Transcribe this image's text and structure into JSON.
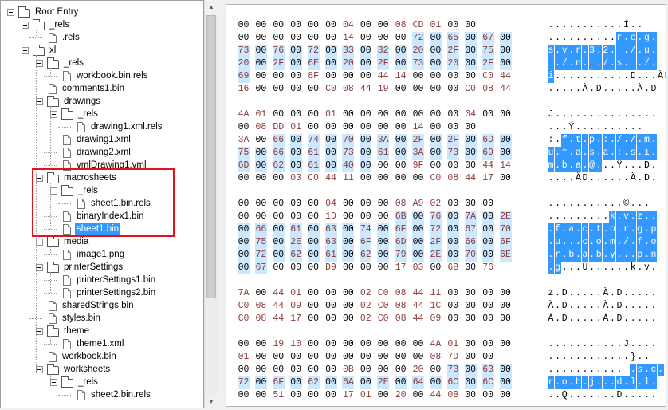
{
  "colors": {
    "highlight_hex": "#cce8ff",
    "highlight_ascii": "#3399ff",
    "selection": "#3399ff",
    "callout_border": "#e0141e",
    "zero_text": "#000000",
    "nonzero_text": "#8b3a3a"
  },
  "tree": {
    "items": [
      {
        "label": "Root Entry",
        "type": "folder",
        "depth": 0,
        "toggle": true
      },
      {
        "label": "_rels",
        "type": "folder",
        "depth": 1,
        "toggle": true
      },
      {
        "label": ".rels",
        "type": "file",
        "depth": 2
      },
      {
        "label": "xl",
        "type": "folder",
        "depth": 1,
        "toggle": true
      },
      {
        "label": "_rels",
        "type": "folder",
        "depth": 2,
        "toggle": true
      },
      {
        "label": "workbook.bin.rels",
        "type": "file",
        "depth": 3
      },
      {
        "label": "comments1.bin",
        "type": "file",
        "depth": 2
      },
      {
        "label": "drawings",
        "type": "folder",
        "depth": 2,
        "toggle": true
      },
      {
        "label": "_rels",
        "type": "folder",
        "depth": 3,
        "toggle": true
      },
      {
        "label": "drawing1.xml.rels",
        "type": "file",
        "depth": 4
      },
      {
        "label": "drawing1.xml",
        "type": "file",
        "depth": 3
      },
      {
        "label": "drawing2.xml",
        "type": "file",
        "depth": 3
      },
      {
        "label": "vmlDrawing1.vml",
        "type": "file",
        "depth": 3
      },
      {
        "label": "macrosheets",
        "type": "folder",
        "depth": 2,
        "toggle": true
      },
      {
        "label": "_rels",
        "type": "folder",
        "depth": 3,
        "toggle": true
      },
      {
        "label": "sheet1.bin.rels",
        "type": "file",
        "depth": 4
      },
      {
        "label": "binaryIndex1.bin",
        "type": "file",
        "depth": 3
      },
      {
        "label": "sheet1.bin",
        "type": "file",
        "depth": 3,
        "selected": true
      },
      {
        "label": "media",
        "type": "folder",
        "depth": 2,
        "toggle": true
      },
      {
        "label": "image1.png",
        "type": "file",
        "depth": 3
      },
      {
        "label": "printerSettings",
        "type": "folder",
        "depth": 2,
        "toggle": true
      },
      {
        "label": "printerSettings1.bin",
        "type": "file",
        "depth": 3
      },
      {
        "label": "printerSettings2.bin",
        "type": "file",
        "depth": 3
      },
      {
        "label": "sharedStrings.bin",
        "type": "file",
        "depth": 2
      },
      {
        "label": "styles.bin",
        "type": "file",
        "depth": 2
      },
      {
        "label": "theme",
        "type": "folder",
        "depth": 2,
        "toggle": true
      },
      {
        "label": "theme1.xml",
        "type": "file",
        "depth": 3
      },
      {
        "label": "workbook.bin",
        "type": "file",
        "depth": 2
      },
      {
        "label": "worksheets",
        "type": "folder",
        "depth": 2,
        "toggle": true
      },
      {
        "label": "_rels",
        "type": "folder",
        "depth": 3,
        "toggle": true
      },
      {
        "label": "sheet2.bin.rels",
        "type": "file",
        "depth": 4
      }
    ]
  },
  "scrollbar": {
    "up_glyph": "▲",
    "down_glyph": "▼"
  },
  "hex": {
    "rows": [
      {
        "bytes": [
          "00",
          "00",
          "00",
          "00",
          "00",
          "00",
          "04",
          "00",
          "00",
          "08",
          "CD",
          "01",
          "00",
          "00"
        ],
        "ascii": "...........Í..",
        "hl": []
      },
      {
        "bytes": [
          "00",
          "00",
          "00",
          "00",
          "00",
          "00",
          "14",
          "00",
          "00",
          "00",
          "72",
          "00",
          "65",
          "00",
          "67",
          "00"
        ],
        "ascii": "..........r.e.g.",
        "hl": [
          10,
          11,
          12,
          13,
          14,
          15
        ]
      },
      {
        "bytes": [
          "73",
          "00",
          "76",
          "00",
          "72",
          "00",
          "33",
          "00",
          "32",
          "00",
          "20",
          "00",
          "2F",
          "00",
          "75",
          "00"
        ],
        "ascii": "s.v.r.3.2. ./.u.",
        "hl": [
          0,
          1,
          2,
          3,
          4,
          5,
          6,
          7,
          8,
          9,
          10,
          11,
          12,
          13,
          14,
          15
        ]
      },
      {
        "bytes": [
          "20",
          "00",
          "2F",
          "00",
          "6E",
          "00",
          "20",
          "00",
          "2F",
          "00",
          "73",
          "00",
          "20",
          "00",
          "2F",
          "00"
        ],
        "ascii": " ./.n. ./.s. ./.",
        "hl": [
          0,
          1,
          2,
          3,
          4,
          5,
          6,
          7,
          8,
          9,
          10,
          11,
          12,
          13,
          14,
          15
        ]
      },
      {
        "bytes": [
          "69",
          "00",
          "00",
          "00",
          "8F",
          "00",
          "00",
          "00",
          "44",
          "14",
          "00",
          "00",
          "00",
          "00",
          "C0",
          "44"
        ],
        "ascii": "i...........D...ÀD",
        "hl": [
          0
        ]
      },
      {
        "bytes": [
          "16",
          "00",
          "00",
          "00",
          "00",
          "C0",
          "08",
          "44",
          "19",
          "00",
          "00",
          "00",
          "00",
          "C0",
          "08",
          "44"
        ],
        "ascii": ".....À.D.....À.D",
        "hl": []
      },
      {
        "bytes": [
          "4A",
          "01",
          "00",
          "00",
          "00",
          "01",
          "00",
          "00",
          "00",
          "00",
          "00",
          "00",
          "00",
          "04",
          "00",
          "00"
        ],
        "ascii": "J...............",
        "hl": []
      },
      {
        "bytes": [
          "00",
          "08",
          "DD",
          "01",
          "00",
          "00",
          "00",
          "00",
          "00",
          "00",
          "14",
          "00",
          "00",
          "00"
        ],
        "ascii": "...Ý..........",
        "hl": []
      },
      {
        "bytes": [
          "3A",
          "00",
          "66",
          "00",
          "74",
          "00",
          "70",
          "00",
          "3A",
          "00",
          "2F",
          "00",
          "2F",
          "00",
          "6D",
          "00"
        ],
        "ascii": ":.f.t.p.:././.m.",
        "hl": [
          2,
          3,
          4,
          5,
          6,
          7,
          8,
          9,
          10,
          11,
          12,
          13,
          14,
          15
        ]
      },
      {
        "bytes": [
          "75",
          "00",
          "66",
          "00",
          "61",
          "00",
          "73",
          "00",
          "61",
          "00",
          "3A",
          "00",
          "73",
          "00",
          "69",
          "00"
        ],
        "ascii": "u.f.a.s.a.:.s.i.",
        "hl": [
          0,
          1,
          2,
          3,
          4,
          5,
          6,
          7,
          8,
          9,
          10,
          11,
          12,
          13,
          14,
          15
        ]
      },
      {
        "bytes": [
          "6D",
          "00",
          "62",
          "00",
          "61",
          "00",
          "40",
          "00",
          "00",
          "00",
          "9F",
          "00",
          "00",
          "00",
          "44",
          "14"
        ],
        "ascii": "m.b.a.@...Ÿ...D.",
        "hl": [
          0,
          1,
          2,
          3,
          4,
          5,
          6,
          7
        ]
      },
      {
        "bytes": [
          "00",
          "00",
          "00",
          "03",
          "C0",
          "44",
          "11",
          "00",
          "00",
          "00",
          "00",
          "C0",
          "08",
          "44",
          "17",
          "00"
        ],
        "ascii": "....ÀD......À.D.",
        "hl": []
      },
      {
        "bytes": [
          "00",
          "00",
          "00",
          "00",
          "00",
          "04",
          "00",
          "00",
          "00",
          "08",
          "A9",
          "02",
          "00",
          "00",
          "00"
        ],
        "ascii": "...........©...",
        "hl": []
      },
      {
        "bytes": [
          "00",
          "00",
          "00",
          "00",
          "00",
          "1D",
          "00",
          "00",
          "00",
          "6B",
          "00",
          "76",
          "00",
          "7A",
          "00",
          "2E"
        ],
        "ascii": ".........k.v.z..",
        "hl": [
          9,
          10,
          11,
          12,
          13,
          14,
          15
        ]
      },
      {
        "bytes": [
          "00",
          "66",
          "00",
          "61",
          "00",
          "63",
          "00",
          "74",
          "00",
          "6F",
          "00",
          "72",
          "00",
          "67",
          "00",
          "70"
        ],
        "ascii": ".f.a.c.t.o.r.g.p",
        "hl": [
          0,
          1,
          2,
          3,
          4,
          5,
          6,
          7,
          8,
          9,
          10,
          11,
          12,
          13,
          14,
          15
        ]
      },
      {
        "bytes": [
          "00",
          "75",
          "00",
          "2E",
          "00",
          "63",
          "00",
          "6F",
          "00",
          "6D",
          "00",
          "2F",
          "00",
          "66",
          "00",
          "6F"
        ],
        "ascii": ".u...c.o.m./.f.o",
        "hl": [
          0,
          1,
          2,
          3,
          4,
          5,
          6,
          7,
          8,
          9,
          10,
          11,
          12,
          13,
          14,
          15
        ]
      },
      {
        "bytes": [
          "00",
          "72",
          "00",
          "62",
          "00",
          "61",
          "00",
          "62",
          "00",
          "79",
          "00",
          "2E",
          "00",
          "70",
          "00",
          "6E"
        ],
        "ascii": ".r.b.a.b.y...p.n",
        "hl": [
          0,
          1,
          2,
          3,
          4,
          5,
          6,
          7,
          8,
          9,
          10,
          11,
          12,
          13,
          14,
          15
        ]
      },
      {
        "bytes": [
          "00",
          "67",
          "00",
          "00",
          "00",
          "D9",
          "00",
          "00",
          "00",
          "17",
          "03",
          "00",
          "6B",
          "00",
          "76"
        ],
        "ascii": ".g...Ù......k.v.",
        "hl": [
          0,
          1
        ]
      },
      {
        "bytes": [
          "7A",
          "00",
          "44",
          "01",
          "00",
          "00",
          "00",
          "02",
          "C0",
          "08",
          "44",
          "11",
          "00",
          "00",
          "00",
          "00"
        ],
        "ascii": "z.D.....À.D.....",
        "hl": []
      },
      {
        "bytes": [
          "C0",
          "08",
          "44",
          "09",
          "00",
          "00",
          "00",
          "02",
          "C0",
          "08",
          "44",
          "1C",
          "00",
          "00",
          "00",
          "00"
        ],
        "ascii": "À.D.....À.D.....",
        "hl": []
      },
      {
        "bytes": [
          "C0",
          "08",
          "44",
          "17",
          "00",
          "00",
          "00",
          "02",
          "C0",
          "08",
          "44",
          "09",
          "00",
          "00",
          "00",
          "00"
        ],
        "ascii": "À.D.....À.D.....",
        "hl": []
      },
      {
        "bytes": [
          "00",
          "00",
          "19",
          "10",
          "00",
          "00",
          "00",
          "00",
          "00",
          "00",
          "00",
          "4A",
          "01",
          "00",
          "00",
          "00"
        ],
        "ascii": "...........J....",
        "hl": []
      },
      {
        "bytes": [
          "01",
          "00",
          "00",
          "00",
          "00",
          "00",
          "00",
          "00",
          "00",
          "00",
          "00",
          "08",
          "7D",
          "00",
          "00"
        ],
        "ascii": "............}..",
        "hl": []
      },
      {
        "bytes": [
          "00",
          "00",
          "00",
          "00",
          "00",
          "00",
          "0B",
          "00",
          "00",
          "00",
          "20",
          "00",
          "73",
          "00",
          "63",
          "00"
        ],
        "ascii": "........... .s.c.",
        "hl": [
          12,
          13,
          14,
          15
        ]
      },
      {
        "bytes": [
          "72",
          "00",
          "6F",
          "00",
          "62",
          "00",
          "6A",
          "00",
          "2E",
          "00",
          "64",
          "00",
          "6C",
          "00",
          "6C",
          "00"
        ],
        "ascii": "r.o.b.j...d.l.l.",
        "hl": [
          0,
          1,
          2,
          3,
          4,
          5,
          6,
          7,
          8,
          9,
          10,
          11,
          12,
          13,
          14,
          15
        ]
      },
      {
        "bytes": [
          "00",
          "00",
          "51",
          "00",
          "00",
          "00",
          "17",
          "01",
          "00",
          "20",
          "00",
          "44",
          "0B",
          "00",
          "00",
          "00"
        ],
        "ascii": "..Q.......D.....",
        "hl": []
      }
    ]
  }
}
